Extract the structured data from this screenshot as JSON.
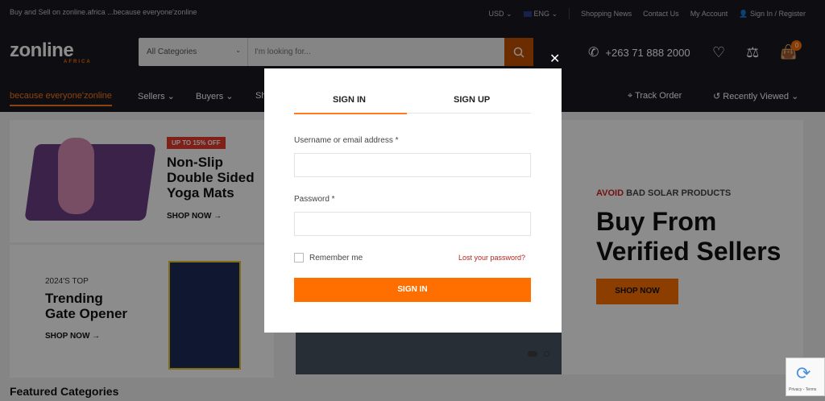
{
  "topbar": {
    "tagline": "Buy and Sell on zonline.africa ...because everyone'zonline",
    "currency": "USD",
    "language": "ENG",
    "shopping_news": "Shopping News",
    "contact": "Contact Us",
    "account": "My Account",
    "signin": "Sign In / Register"
  },
  "header": {
    "logo": "zonline",
    "logo_sub": "AFRICA",
    "category": "All Categories",
    "search_placeholder": "I'm looking for...",
    "phone": "+263 71 888 2000",
    "cart_count": "0"
  },
  "nav": {
    "tagline": "because everyone'zonline",
    "sellers": "Sellers",
    "buyers": "Buyers",
    "sh": "Sh",
    "track": "Track Order",
    "recent": "Recently Viewed"
  },
  "promos": {
    "yoga": {
      "badge": "UP TO 15% OFF",
      "title1": "Non-Slip",
      "title2": "Double Sided",
      "title3": "Yoga Mats",
      "cta": "SHOP NOW"
    },
    "gate": {
      "kicker": "2024'S TOP",
      "title1": "Trending",
      "title2": "Gate Opener",
      "cta": "SHOP NOW"
    },
    "solar": {
      "kicker_red": "AVOID",
      "kicker": "BAD SOLAR PRODUCTS",
      "title1": "Buy From",
      "title2": "Verified Sellers",
      "cta": "SHOP NOW"
    }
  },
  "featured": "Featured Categories",
  "recaptcha": "Privacy - Terms",
  "modal": {
    "tab_signin": "SIGN IN",
    "tab_signup": "SIGN UP",
    "user_label": "Username or email address *",
    "pass_label": "Password *",
    "remember": "Remember me",
    "lost": "Lost your password?",
    "submit": "SIGN IN"
  },
  "colors": {
    "accent": "#ff6f00",
    "dark": "#1a1a22"
  }
}
